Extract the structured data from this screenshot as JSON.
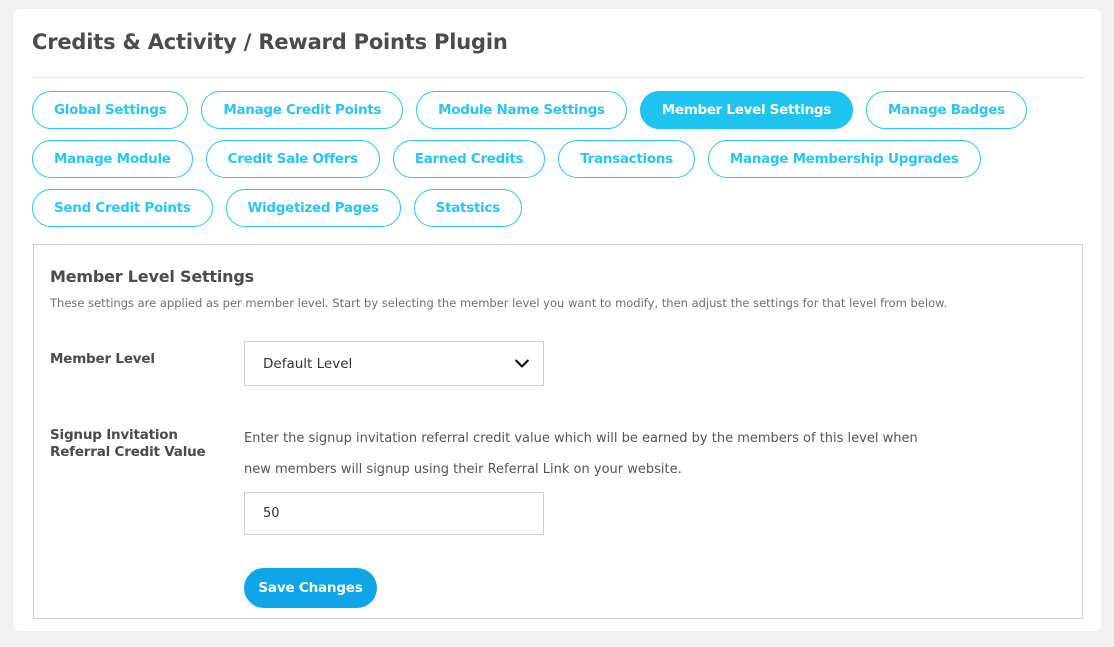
{
  "page": {
    "title": "Credits & Activity / Reward Points Plugin"
  },
  "tabs": [
    {
      "label": "Global Settings",
      "active": false
    },
    {
      "label": "Manage Credit Points",
      "active": false
    },
    {
      "label": "Module Name Settings",
      "active": false
    },
    {
      "label": "Member Level Settings",
      "active": true
    },
    {
      "label": "Manage Badges",
      "active": false
    },
    {
      "label": "Manage Module",
      "active": false
    },
    {
      "label": "Credit Sale Offers",
      "active": false
    },
    {
      "label": "Earned Credits",
      "active": false
    },
    {
      "label": "Transactions",
      "active": false
    },
    {
      "label": "Manage Membership Upgrades",
      "active": false
    },
    {
      "label": "Send Credit Points",
      "active": false
    },
    {
      "label": "Widgetized Pages",
      "active": false
    },
    {
      "label": "Statstics",
      "active": false
    }
  ],
  "panel": {
    "title": "Member Level Settings",
    "description": "These settings are applied as per member level. Start by selecting the member level you want to modify, then adjust the settings for that level from below.",
    "member_level": {
      "label": "Member Level",
      "selected": "Default Level",
      "options": [
        "Default Level"
      ]
    },
    "signup_referral": {
      "label": "Signup Invitation Referral Credit Value",
      "help_line1": "Enter the signup invitation referral credit value which will be earned by the members of this level when",
      "help_line2": "new members will signup using their Referral Link on your website.",
      "value": "50",
      "placeholder": ""
    },
    "save_label": "Save Changes"
  },
  "colors": {
    "accent": "#29c5f6",
    "accent_active": "#1ec3f0",
    "button": "#0ea5e9",
    "text_dark": "#4c4a4a"
  }
}
